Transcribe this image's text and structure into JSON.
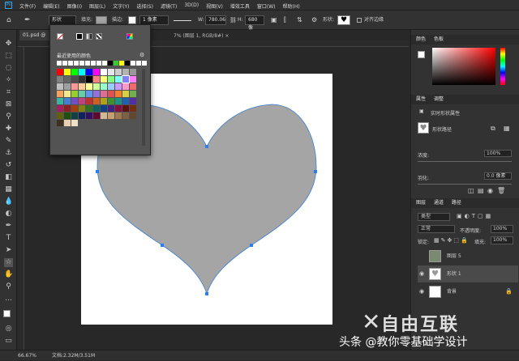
{
  "menubar": {
    "logo": "Ps",
    "items": [
      "文件(F)",
      "编辑(E)",
      "图像(I)",
      "图层(L)",
      "文字(Y)",
      "选择(S)",
      "滤镜(T)",
      "3D(D)",
      "视图(V)",
      "增效工具",
      "窗口(W)",
      "帮助(H)"
    ]
  },
  "options": {
    "mode": "形状",
    "fill_label": "填充:",
    "stroke_label": "描边:",
    "stroke_size": "1 像素",
    "w_label": "W:",
    "w_value": "780.06",
    "h_label": "H:",
    "h_value": "680 像",
    "shape_label": "形状:",
    "align_edges": "对齐边缘"
  },
  "document": {
    "tab_title": "01.psd @ 66",
    "title_tail": "7% (图层 1, RGB/8#) ×"
  },
  "color_popup": {
    "recent_title": "最近使用的颜色",
    "recent_colors": [
      "#ffffff",
      "#ffffff",
      "#ffffff",
      "#ffffff",
      "#ffffff",
      "#ffffff",
      "#ffffff",
      "#ffffff",
      "#ffffff",
      "#000000",
      "#33cc33",
      "#ffff00",
      "#000000",
      "#ffffff",
      "#ffffff",
      "#ffffff"
    ],
    "swatch_colors": [
      "#ff0000",
      "#ffff00",
      "#00ff00",
      "#00ffff",
      "#0000ff",
      "#ff00ff",
      "#ffffff",
      "#e6e6e6",
      "#cccccc",
      "#b3b3b3",
      "#999999",
      "#808080",
      "#666666",
      "#4d4d4d",
      "#333333",
      "#000000",
      "#ff8080",
      "#ffff80",
      "#80ff80",
      "#80ffff",
      "#8080ff",
      "#ff80ff",
      "#c0c0c0",
      "#a0a0a0",
      "#ff9999",
      "#ffcc99",
      "#ffff99",
      "#ccff99",
      "#99ffcc",
      "#99ccff",
      "#cc99ff",
      "#ff99cc",
      "#f26b6b",
      "#f4a460",
      "#f0e68c",
      "#9acd32",
      "#66cdaa",
      "#6495ed",
      "#9370db",
      "#db7093",
      "#e05050",
      "#f08030",
      "#d8d040",
      "#70b050",
      "#40b0a0",
      "#4080d0",
      "#7050c0",
      "#c04080",
      "#c03030",
      "#d06020",
      "#b0a020",
      "#409030",
      "#209080",
      "#2060b0",
      "#5030a0",
      "#a02060",
      "#902020",
      "#a04010",
      "#808010",
      "#307020",
      "#106060",
      "#104080",
      "#402080",
      "#801040",
      "#601010",
      "#703010",
      "#606010",
      "#205010",
      "#104040",
      "#102060",
      "#301060",
      "#600830",
      "#d4b896",
      "#c8a070",
      "#a07850",
      "#806040",
      "#604830",
      "#403020",
      "#e8d0b0",
      "#f0e0c8"
    ]
  },
  "right_panel": {
    "color_tabs": [
      "颜色",
      "色板"
    ],
    "props_tabs": [
      "属性",
      "调整"
    ],
    "props_kind": "实时形状属性",
    "props_shape": "形状路径",
    "opacity_label": "浓度:",
    "opacity_value": "100%",
    "feather_label": "羽化:",
    "feather_value": "0.0 像素",
    "layers_tabs": [
      "图层",
      "通道",
      "路径"
    ],
    "kind_filter": "类型",
    "blend_mode": "正常",
    "opacity2_label": "不透明度:",
    "opacity2_value": "100%",
    "lock_label": "锁定:",
    "fill_label": "填充:",
    "fill_value": "100%",
    "layers": [
      {
        "name": "图层 5",
        "visible": false
      },
      {
        "name": "形状 1",
        "visible": true
      },
      {
        "name": "背景",
        "visible": true
      }
    ]
  },
  "status": {
    "zoom": "66.67%",
    "doc": "文档:2.32M/3.51M"
  },
  "watermark": {
    "logo_text": "自由互联",
    "credit": "头条 @教你零基础学设计"
  },
  "colors": {
    "heart_fill": "#a5a5a5",
    "path_stroke": "#3b7fd4",
    "anchor": "#2a7ff0"
  }
}
